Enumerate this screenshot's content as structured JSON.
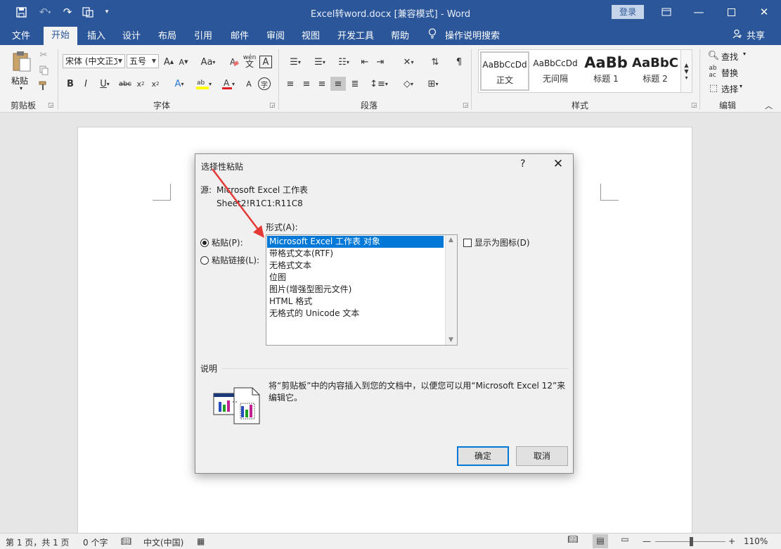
{
  "titlebar": {
    "title": "Excel转word.docx [兼容模式]  -  Word",
    "login": "登录"
  },
  "tabs": [
    "文件",
    "开始",
    "插入",
    "设计",
    "布局",
    "引用",
    "邮件",
    "审阅",
    "视图",
    "开发工具",
    "帮助"
  ],
  "tell_me": "操作说明搜索",
  "share": "共享",
  "ribbon": {
    "clipboard": {
      "paste": "粘贴",
      "label": "剪贴板"
    },
    "font": {
      "name": "宋体 (中文正文)",
      "size": "五号",
      "label": "字体"
    },
    "paragraph": {
      "label": "段落"
    },
    "styles": {
      "label": "样式",
      "items": [
        {
          "sample": "AaBbCcDd",
          "name": "正文"
        },
        {
          "sample": "AaBbCcDd",
          "name": "无间隔"
        },
        {
          "sample": "AaBb",
          "name": "标题 1"
        },
        {
          "sample": "AaBbC",
          "name": "标题 2"
        }
      ]
    },
    "editing": {
      "find": "查找",
      "replace": "替换",
      "select": "选择",
      "label": "编辑"
    }
  },
  "dialog": {
    "title": "选择性粘贴",
    "help": "?",
    "source_label": "源:",
    "source_value": "Microsoft Excel 工作表",
    "source_range": "Sheet2!R1C1:R11C8",
    "format_label": "形式(A):",
    "paste_option": "粘贴(P):",
    "paste_link_option": "粘贴链接(L):",
    "formats": [
      "Microsoft Excel 工作表 对象",
      "带格式文本(RTF)",
      "无格式文本",
      "位图",
      "图片(增强型图元文件)",
      "HTML 格式",
      "无格式的 Unicode 文本"
    ],
    "display_as_icon": "显示为图标(D)",
    "description_label": "说明",
    "description": "将“剪贴板”中的内容插入到您的文档中，以便您可以用“Microsoft Excel 12”来编辑它。",
    "ok": "确定",
    "cancel": "取消"
  },
  "statusbar": {
    "page": "第 1 页，共 1 页",
    "words": "0 个字",
    "language": "中文(中国)",
    "zoom": "110%"
  },
  "colors": {
    "brand": "#2b579a",
    "selection": "#0078d7",
    "annotation_arrow": "#e53935"
  }
}
